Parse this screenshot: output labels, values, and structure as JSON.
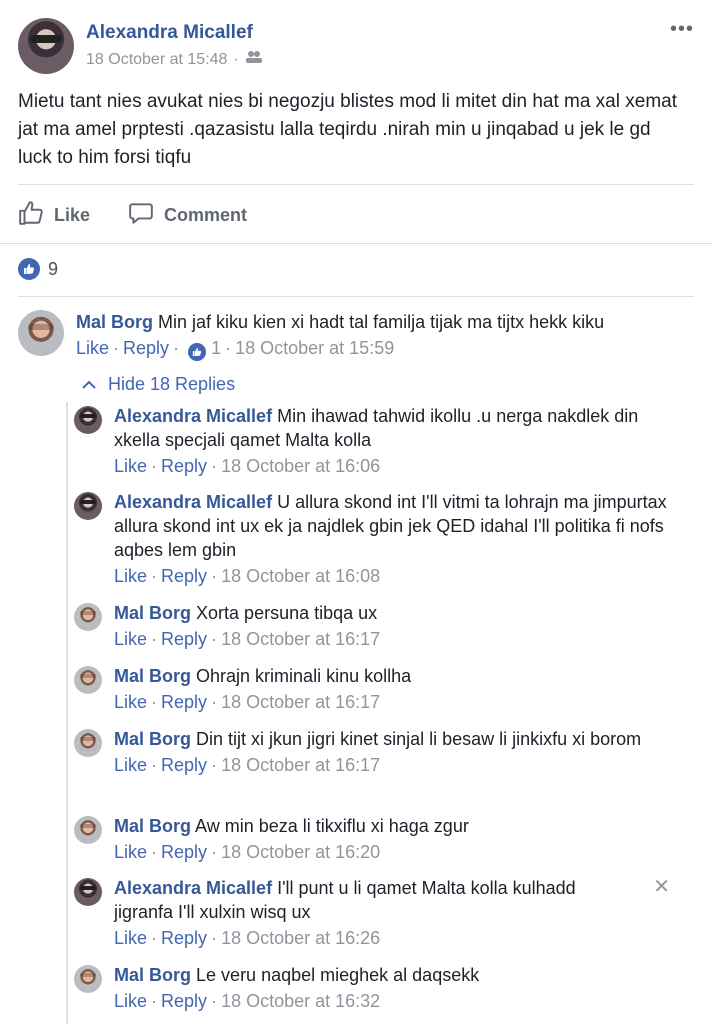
{
  "post": {
    "author": "Alexandra Micallef",
    "timestamp": "18 October at 15:48",
    "audience_icon": "friends-icon",
    "more_label": "•••",
    "text": "Mietu tant nies avukat nies bi negozju blistes mod li mitet din hat ma xal xemat jat ma amel prptesti .qazasistu lalla teqirdu .nirah min u jinqabad u jek le gd luck to him forsi tiqfu"
  },
  "actions": {
    "like": "Like",
    "comment": "Comment"
  },
  "reactions": {
    "count": "9"
  },
  "top_comment": {
    "author": "Mal Borg",
    "text": "Min jaf kiku kien xi hadt tal familja tijak ma tijtx hekk kiku",
    "like": "Like",
    "reply": "Reply",
    "like_count": "1",
    "timestamp": "18 October at 15:59"
  },
  "hide_replies_label": "Hide 18 Replies",
  "replies": [
    {
      "author": "Alexandra Micallef",
      "text": "Min ihawad tahwid ikollu .u nerga nakdlek din xkella specjali qamet Malta kolla",
      "like": "Like",
      "reply": "Reply",
      "timestamp": "18 October at 16:06"
    },
    {
      "author": "Alexandra Micallef",
      "text": "U allura skond int I'll vitmi ta lohrajn ma jimpurtax allura skond int ux ek ja najdlek gbin jek QED idahal I'll politika fi nofs aqbes lem gbin",
      "like": "Like",
      "reply": "Reply",
      "timestamp": "18 October at 16:08"
    },
    {
      "author": "Mal Borg",
      "text": "Xorta persuna tibqa ux",
      "like": "Like",
      "reply": "Reply",
      "timestamp": "18 October at 16:17"
    },
    {
      "author": "Mal Borg",
      "text": "Ohrajn kriminali kinu kollha",
      "like": "Like",
      "reply": "Reply",
      "timestamp": "18 October at 16:17"
    },
    {
      "author": "Mal Borg",
      "text": "Din tijt xi jkun jigri kinet sinjal li besaw li jinkixfu xi borom",
      "like": "Like",
      "reply": "Reply",
      "timestamp": "18 October at 16:17"
    },
    {
      "author": "Mal Borg",
      "text": "Aw min beza li tikxiflu xi haga zgur",
      "like": "Like",
      "reply": "Reply",
      "timestamp": "18 October at 16:20"
    },
    {
      "author": "Alexandra Micallef",
      "text": "I'll punt u li qamet Malta kolla kulhadd jigranfa I'll xulxin wisq ux",
      "like": "Like",
      "reply": "Reply",
      "timestamp": "18 October at 16:26"
    },
    {
      "author": "Mal Borg",
      "text": "Le veru naqbel mieghek al daqsekk",
      "like": "Like",
      "reply": "Reply",
      "timestamp": "18 October at 16:32"
    }
  ],
  "close_label": "✕"
}
